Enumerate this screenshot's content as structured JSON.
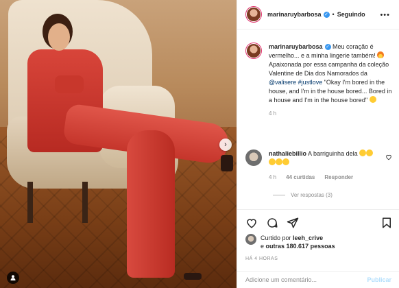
{
  "header": {
    "username": "marinaruybarbosa",
    "separator": "•",
    "follow_label": "Seguindo",
    "more_icon": "more-dots-icon"
  },
  "caption": {
    "username": "marinaruybarbosa",
    "text_1": "Meu coração é vermelho... e a minha lingerie também!",
    "text_2": "Apaixonada por essa campanha da coleção Valentine de Dia dos Namorados da",
    "mention": "@valisere",
    "hashtag": "#justlove",
    "quote": "\"Okay I'm bored in the house, and I'm in the house bored... Bored in a house and I'm in the house bored\"",
    "time": "4 h"
  },
  "comment": {
    "username": "nathaliebillio",
    "text": "A barriguinha dela",
    "time": "4 h",
    "likes": "44 curtidas",
    "reply_label": "Responder",
    "view_replies": "Ver respostas (3)"
  },
  "actions": {
    "liked_prefix": "Curtido por",
    "liked_user": "leeh_crive",
    "liked_conj": "e",
    "liked_others": "outras 180.617 pessoas",
    "time_ago": "HÁ 4 HORAS"
  },
  "add_comment": {
    "placeholder": "Adicione um comentário...",
    "publish_label": "Publicar"
  },
  "colors": {
    "accent_blue": "#3897f0",
    "publish_disabled": "#b2dffc",
    "muted": "#8e8e8e"
  }
}
